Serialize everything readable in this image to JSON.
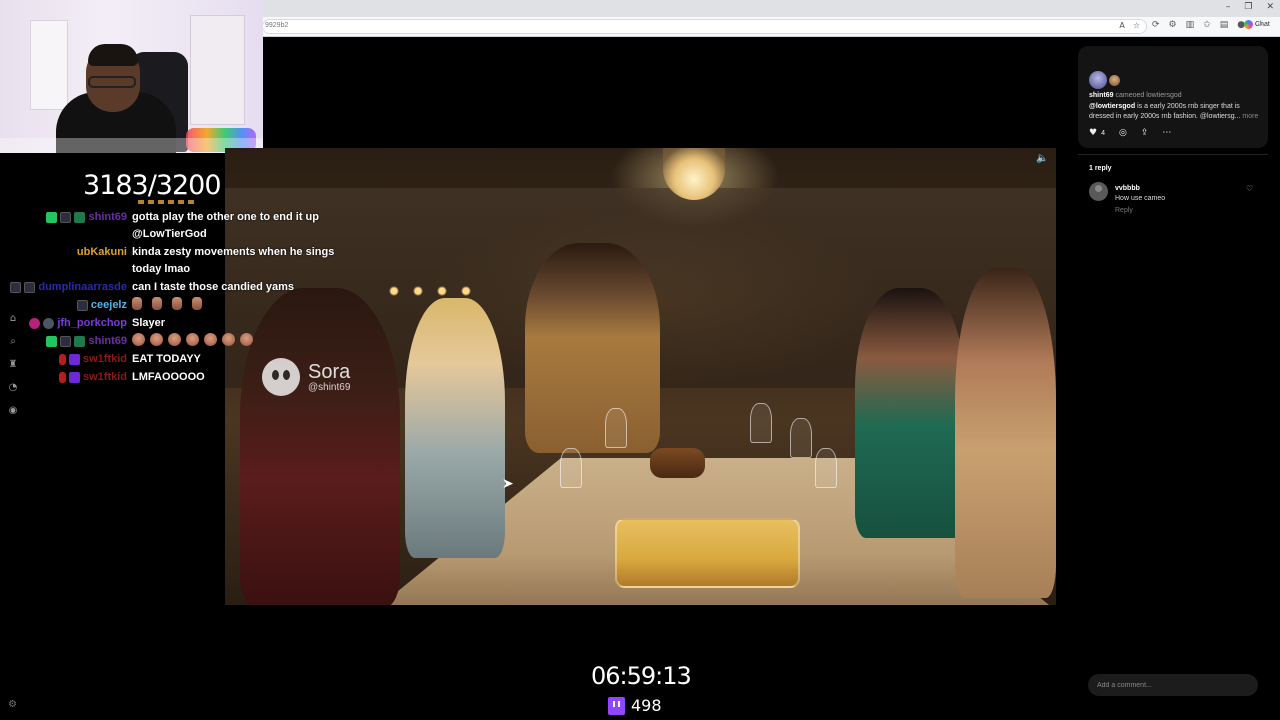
{
  "browser": {
    "url": "9929b2",
    "copilot_label": "Chat"
  },
  "stream": {
    "sub_count": "3183/3200",
    "uptime": "06:59:13",
    "viewers": "498"
  },
  "chat": [
    {
      "user": "shint69",
      "user_color": "#6b2ea8",
      "badges": [
        "green",
        "dark",
        "gift"
      ],
      "lines": [
        "gotta play the other one to end it up",
        "@LowTierGod"
      ]
    },
    {
      "user": "ubKakuni",
      "user_color": "#e0a030",
      "badges": [],
      "lines": [
        "kinda zesty movements when he sings",
        "today lmao"
      ]
    },
    {
      "user": "dumplinaarrasde",
      "user_color": "#2a2aaa",
      "badges": [
        "dark",
        "dark"
      ],
      "lines": [
        "can I taste those candied yams"
      ]
    },
    {
      "user": "ceejelz",
      "user_color": "#4fb4e8",
      "badges": [
        "dark"
      ],
      "lines": [
        ""
      ],
      "emote_count": 4
    },
    {
      "user": "jfh_porkchop",
      "user_color": "#7a3ad8",
      "badges": [
        "pink",
        "grey"
      ],
      "lines": [
        "Slayer"
      ]
    },
    {
      "user": "shint69",
      "user_color": "#6b2ea8",
      "badges": [
        "green",
        "dark",
        "gift"
      ],
      "lines": [
        ""
      ],
      "emote_count": 7
    },
    {
      "user": "sw1ftkid",
      "user_color": "#8a1a1a",
      "badges": [
        "red",
        "purple"
      ],
      "lines": [
        "EAT TODAYY"
      ]
    },
    {
      "user": "sw1ftkid",
      "user_color": "#8a1a1a",
      "badges": [
        "red",
        "purple"
      ],
      "lines": [
        "LMFAOOOOO"
      ]
    }
  ],
  "video": {
    "watermark_name": "Sora",
    "watermark_handle": "@shint69"
  },
  "post": {
    "author": "shint69",
    "action": "cameoed lowtiersgod",
    "mention": "@lowtiersgod",
    "text": "is a early 2000s rnb singer that is dressed in early 2000s rnb fashion. @lowtiersg...",
    "more_label": "more",
    "like_count": "4"
  },
  "replies": {
    "count_label": "1 reply",
    "comments": [
      {
        "user": "vvbbbb",
        "text": "How use cameo",
        "reply_label": "Reply"
      }
    ]
  },
  "comment_input": {
    "placeholder": "Add a comment..."
  }
}
